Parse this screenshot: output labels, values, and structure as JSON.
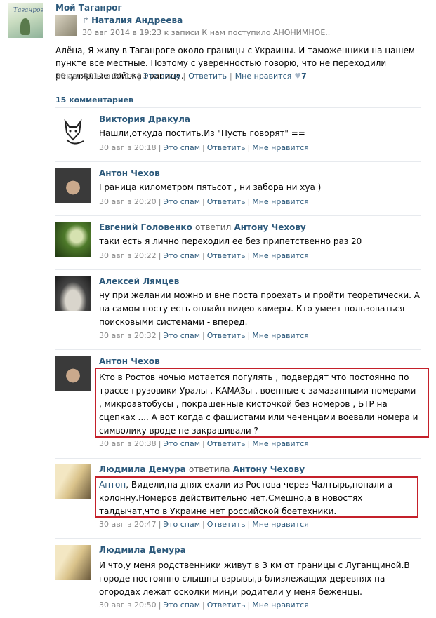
{
  "group": {
    "name": "Мой Таганрог",
    "avatar_text": "Таганрог"
  },
  "repost": {
    "author": "Наталия Андреева",
    "meta": "30 авг 2014 в 19:23 к записи К нам поступило АНОНИМНОЕ.."
  },
  "post": {
    "text": "Алёна, Я живу в Таганроге около границы с Украины. И таможенники на нашем пункте все местные. Поэтому с уверенностью говорю, что не переходили регулярные войска границу.",
    "date": "30 авг 2014 в 20:14",
    "spam": "Это спам",
    "reply": "Ответить",
    "like": "Мне нравится",
    "like_count": "7"
  },
  "comments_count": "15 комментариев",
  "actions": {
    "spam": "Это спам",
    "reply": "Ответить",
    "like": "Мне нравится"
  },
  "comments": [
    {
      "author": "Виктория Дракула",
      "replied": "",
      "reply_to": "",
      "text": "Нашли,откуда постить.Из \"Пусть говорят\" ==",
      "date": "30 авг в 20:18"
    },
    {
      "author": "Антон Чехов",
      "replied": "",
      "reply_to": "",
      "text": "Граница километром пятьсот , ни забора ни хуа )",
      "date": "30 авг в 20:20"
    },
    {
      "author": "Евгений Головенко",
      "replied": "ответил",
      "reply_to": "Антону Чехову",
      "text": "таки есть я лично переходил ее без припетственно раз 20",
      "date": "30 авг в 20:22"
    },
    {
      "author": "Алексей Лямцев",
      "replied": "",
      "reply_to": "",
      "text": "ну при желании можно и вне поста проехать и пройти теоретически. А на самом посту есть онлайн видео камеры. Кто умеет пользоваться поисковыми системами - вперед.",
      "date": "30 авг в 20:32"
    },
    {
      "author": "Антон Чехов",
      "replied": "",
      "reply_to": "",
      "text": "Кто в Ростов ночью мотается погулять , подвердят что постоянно по трассе грузовики Уралы , КАМАЗы , военные с замазанными номерами , микроавтобусы , покрашенные кисточкой без номеров , БТР на сцепках .... А вот когда с фашистами или чеченцами воевали номера и символику вроде не закрашивали ?",
      "date": "30 авг в 20:38"
    },
    {
      "author": "Людмила Демура",
      "replied": "ответила",
      "reply_to": "Антону Чехову",
      "text_link": "Антон",
      "text": ", Видели,на днях ехали из Ростова через Чалтырь,попали а колонну.Номеров действительно нет.Смешно,а в новостях талдычат,что в Украине нет российской боетехники.",
      "date": "30 авг в 20:47"
    },
    {
      "author": "Людмила Демура",
      "replied": "",
      "reply_to": "",
      "text": "И что,у меня родственники живут в 3 км от границы с Луганщиной.В городе постоянно слышны взрывы,в близлежащих деревнях на огородах лежат осколки мин,и родители у меня беженцы.",
      "date": "30 авг в 20:50"
    }
  ]
}
